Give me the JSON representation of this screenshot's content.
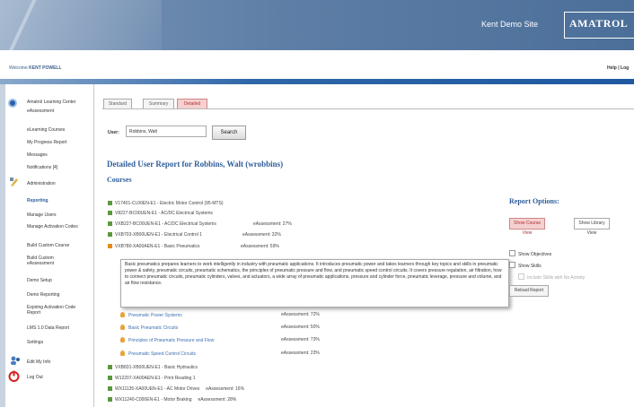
{
  "header": {
    "site_name": "Kent Demo Site",
    "logo_text": "AMATROL"
  },
  "welcome": {
    "prefix": "Welcome ",
    "user": "KENT POWELL",
    "help": "Help | Log"
  },
  "sidebar": {
    "learning_center": "Amatrol Learning Center",
    "assessment": "eAssessment",
    "items_top": [
      "eLearning Courses",
      "My Progress Report",
      "Messages",
      "Notifications [4]"
    ],
    "administration": "Administration",
    "items_admin": [
      "Reporting",
      "Manage Users",
      "Manage Activation Codes",
      "Build Custom Course",
      "Build Custom eAssessment",
      "Demo Setup",
      "Demo Reporting",
      "Expiring Activation Code Report",
      "LMS 1.0 Data Report",
      "Settings"
    ],
    "edit_info": "Edit My Info",
    "logout": "Log Out"
  },
  "tabs": [
    "Standard",
    "Summary",
    "Detailed"
  ],
  "user_search": {
    "label": "User:",
    "value": "Robbins, Walt",
    "button": "Search"
  },
  "report_title": "Detailed User Report for Robbins, Walt (wrobbins)",
  "courses_heading": "Courses",
  "courses_top": [
    {
      "name": "V17401-CL00EN-E1 - Electric Motor Control (95-MTS)",
      "assessment": ""
    },
    {
      "name": "V8227-BC00UEN-E1 - AC/DC Electrical Systems",
      "assessment": ""
    },
    {
      "name": "VXB227-BC00UEN-E1 - AC/DC Electrical Systems",
      "assessment": "eAssessment: 27%"
    },
    {
      "name": "VXB703-XB00UEN-E1 - Electrical Control 1",
      "assessment": "eAssessment: 32%"
    },
    {
      "name": "VXB780-XA00AEN-E1 - Basic Pneumatics",
      "assessment": "eAssessment: 59%"
    }
  ],
  "description": "Basic pneumatics prepares learners to work intelligently in industry with pneumatic applications. It introduces pneumatic power and takes learners through key topics and skills in pneumatic power & safety, pneumatic circuits, pneumatic schematics, the principles of pneumatic pressure and flow, and pneumatic speed control circuits. It covers pressure regulation, air filtration, how to connect pneumatic circuits, pneumatic cylinders, valves, and actuators, a wide array of pneumatic applications, pressure and cylinder force, pneumatic leverage, pressure and volume, and air flow resistance.",
  "sub_items": [
    {
      "name": "Pneumatic Power Systems",
      "assessment": "eAssessment: 72%"
    },
    {
      "name": "Basic Pneumatic Circuits",
      "assessment": "eAssessment: 50%"
    },
    {
      "name": "Principles of Pneumatic Pressure and Flow",
      "assessment": "eAssessment: 73%"
    },
    {
      "name": "Pneumatic Speed Control Circuits",
      "assessment": "eAssessment: 23%"
    }
  ],
  "courses_bottom": [
    "VXB831-XB00UEN-E1 - Basic Hydraulics",
    "W12207-XA00AEN-E1 - Print Reading 1",
    "WX11135-XA00UEN-E1 - AC Motor Drives     eAssessment: 16%",
    "WX11240-C000EN-E1 - Motor Braking     eAssessment: 28%"
  ],
  "options": {
    "heading": "Report Options:",
    "course_view": "Show Course View",
    "library_view": "Show Library View",
    "show_objectives": "Show Objectives",
    "show_skills": "Show Skills",
    "include_skills": "Include Skills with No Activity",
    "reload": "Reload Report"
  }
}
